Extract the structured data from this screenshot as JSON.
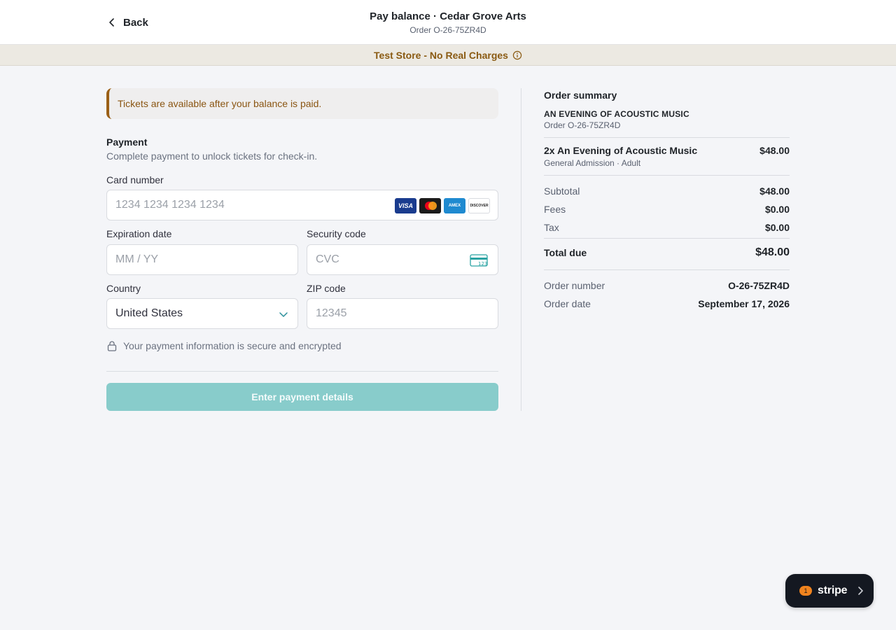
{
  "header": {
    "back_label": "Back",
    "title": "Pay balance · Cedar Grove Arts",
    "subtitle": "Order O-26-75ZR4D"
  },
  "banner": {
    "text": "Test Store - No Real Charges",
    "icon": "info-icon"
  },
  "notice": {
    "text": "Tickets are available after your balance is paid."
  },
  "payment": {
    "title": "Payment",
    "subtitle": "Complete payment to unlock tickets for check-in.",
    "card_number": {
      "label": "Card number",
      "placeholder": "1234 1234 1234 1234",
      "value": ""
    },
    "card_brands": [
      "VISA",
      "mastercard",
      "AMEX",
      "DISCOVER"
    ],
    "expiration": {
      "label": "Expiration date",
      "placeholder": "MM / YY",
      "value": ""
    },
    "security_code": {
      "label": "Security code",
      "placeholder": "CVC",
      "value": ""
    },
    "country": {
      "label": "Country",
      "selected": "United States"
    },
    "zip": {
      "label": "ZIP code",
      "placeholder": "12345",
      "value": ""
    },
    "secure_note": "Your payment information is secure and encrypted",
    "submit_label": "Enter payment details"
  },
  "summary": {
    "title": "Order summary",
    "event_name": "AN EVENING OF ACOUSTIC MUSIC",
    "order_ref": "Order O-26-75ZR4D",
    "items": [
      {
        "name": "2x An Evening of Acoustic Music",
        "desc": "General Admission · Adult",
        "price": "$48.00"
      }
    ],
    "subtotal": {
      "label": "Subtotal",
      "value": "$48.00"
    },
    "fees": {
      "label": "Fees",
      "value": "$0.00"
    },
    "tax": {
      "label": "Tax",
      "value": "$0.00"
    },
    "total": {
      "label": "Total due",
      "value": "$48.00"
    },
    "order_number": {
      "label": "Order number",
      "value": "O-26-75ZR4D"
    },
    "order_date": {
      "label": "Order date",
      "value": "September 17, 2026"
    }
  },
  "stripe_badge": {
    "count": "1",
    "label": "stripe"
  },
  "colors": {
    "accent": "#88cccb",
    "banner_text": "#8a5a12",
    "notice_border": "#9a5f16",
    "stripe_bg": "#141821",
    "stripe_count_bg": "#f0831e"
  }
}
